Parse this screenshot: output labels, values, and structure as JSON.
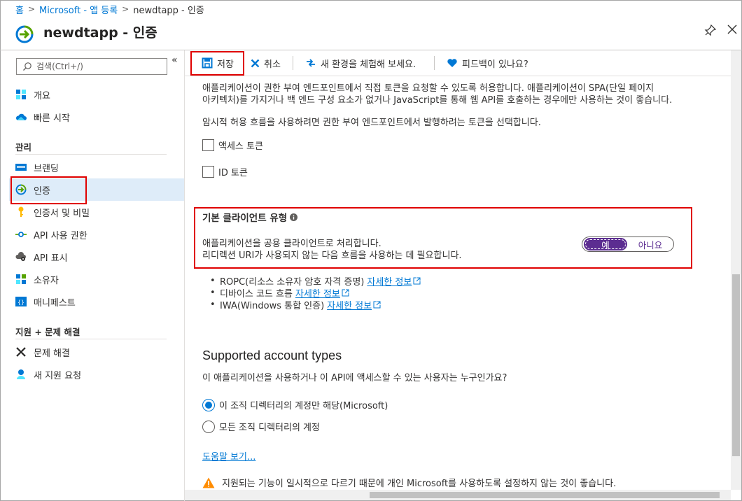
{
  "breadcrumb": {
    "home": "홈",
    "app_registrations": "Microsoft - 앱 등록",
    "current": "newdtapp - 인증"
  },
  "header": {
    "title": "newdtapp - 인증"
  },
  "sidebar": {
    "search_placeholder": "검색(Ctrl+/)",
    "items_top": [
      {
        "label": "개요",
        "icon": "overview-grid-icon"
      },
      {
        "label": "빠른 시작",
        "icon": "cloud-icon"
      }
    ],
    "section_manage": "관리",
    "items_manage": [
      {
        "label": "브랜딩",
        "icon": "branding-icon"
      },
      {
        "label": "인증",
        "icon": "authentication-icon",
        "active": true
      },
      {
        "label": "인증서 및 비밀",
        "icon": "key-icon"
      },
      {
        "label": "API 사용 권한",
        "icon": "api-permissions-icon"
      },
      {
        "label": "API 표시",
        "icon": "cloud-gear-icon"
      },
      {
        "label": "소유자",
        "icon": "owners-grid-icon"
      },
      {
        "label": "매니페스트",
        "icon": "manifest-icon"
      }
    ],
    "section_support": "지원 + 문제 해결",
    "items_support": [
      {
        "label": "문제 해결",
        "icon": "tools-icon"
      },
      {
        "label": "새 지원 요청",
        "icon": "support-person-icon"
      }
    ]
  },
  "toolbar": {
    "save": "저장",
    "discard": "취소",
    "new_experience": "새 환경을 체험해 보세요.",
    "feedback": "피드백이 있나요?"
  },
  "implicit": {
    "desc_line1": "애플리케이션이 권한 부여 엔드포인트에서 직접 토큰을 요청할 수 있도록 허용합니다. 애플리케이션이 SPA(단일 페이지",
    "desc_line2": "아키텍처)를 가지거나 백 엔드 구성 요소가 없거나 JavaScript를 통해 웹 API를 호출하는 경우에만 사용하는 것이 좋습니다.",
    "select_prompt": "암시적 허용 흐름을 사용하려면 권한 부여 엔드포인트에서 발행하려는 토큰을 선택합니다.",
    "access_token": "액세스 토큰",
    "id_token": "ID 토큰",
    "access_token_checked": false,
    "id_token_checked": false
  },
  "client_type": {
    "title": "기본 클라이언트 유형",
    "desc_line1": "애플리케이션을 공용 클라이언트로 처리합니다.",
    "desc_line2": "리디렉션 URI가 사용되지 않는 다음 흐름을 사용하는 데 필요합니다.",
    "toggle_yes": "예",
    "toggle_no": "아니요",
    "selected": "예",
    "flows": [
      {
        "text": "ROPC(리소스 소유자 암호 자격 증명)",
        "link": "자세한 정보"
      },
      {
        "text": "디바이스 코드 흐름",
        "link": "자세한 정보"
      },
      {
        "text": "IWA(Windows 통합 인증)",
        "link": "자세한 정보"
      }
    ]
  },
  "account_types": {
    "title": "Supported account types",
    "question": "이 애플리케이션을 사용하거나 이 API에 액세스할 수 있는 사용자는 누구인가요?",
    "option_single": "이 조직 디렉터리의 계정만 해당(Microsoft)",
    "option_multi": "모든 조직 디렉터리의 계정",
    "selected": "이 조직 디렉터리의 계정만 해당(Microsoft)",
    "help_link": "도움말 보기...",
    "warning": "지원되는 기능이 일시적으로 다르기 때문에 개인 Microsoft를 사용하도록 설정하지 않는 것이 좋습니다."
  },
  "colors": {
    "accent": "#0078d4",
    "toggle_on": "#5c2d91",
    "highlight_box": "#e00000",
    "active_nav": "#deecf9",
    "warning": "#ff8c00"
  }
}
